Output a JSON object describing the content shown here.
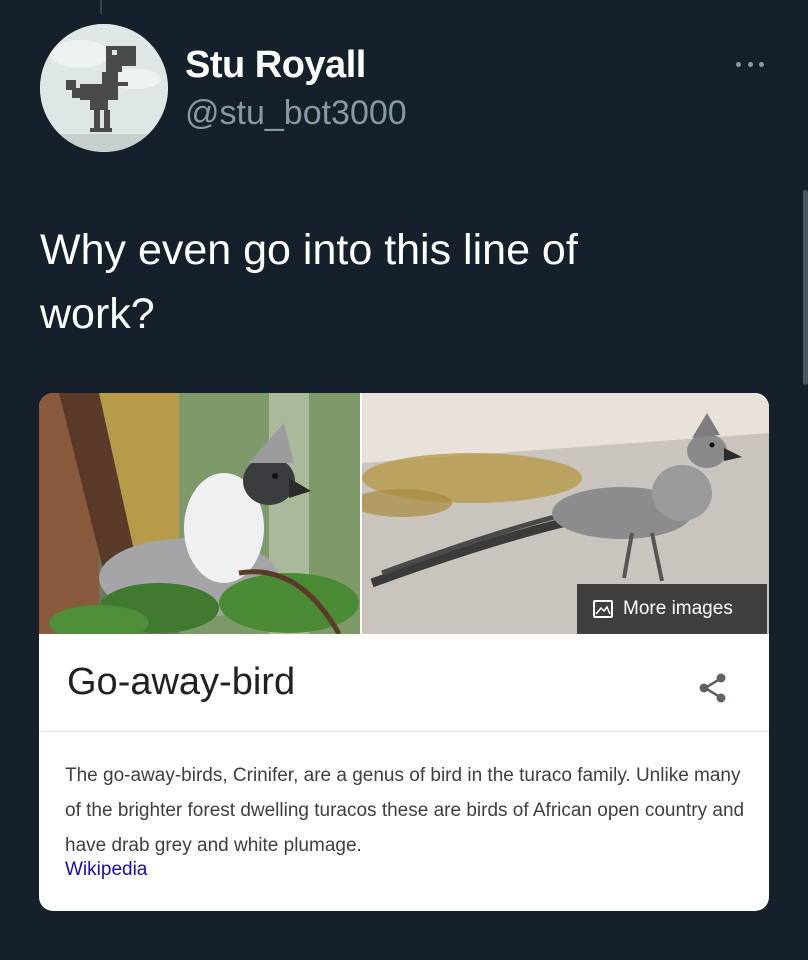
{
  "author": {
    "name": "Stu Royall",
    "handle": "@stu_bot3000"
  },
  "tweet": {
    "text_line1": "Why even go into this line of",
    "text_line2": "work?"
  },
  "card": {
    "more_images_label": "More images",
    "title": "Go-away-bird",
    "description": "The go-away-birds, Crinifer, are a genus of bird in the turaco family. Unlike many of the brighter forest dwelling turacos these are birds of African open country and have drab grey and white plumage.",
    "source": "Wikipedia"
  },
  "colors": {
    "background": "#15202b",
    "secondary_text": "#8899a6",
    "link": "#1a0dab"
  },
  "icons": [
    "more-options-icon",
    "image-icon",
    "share-icon"
  ]
}
